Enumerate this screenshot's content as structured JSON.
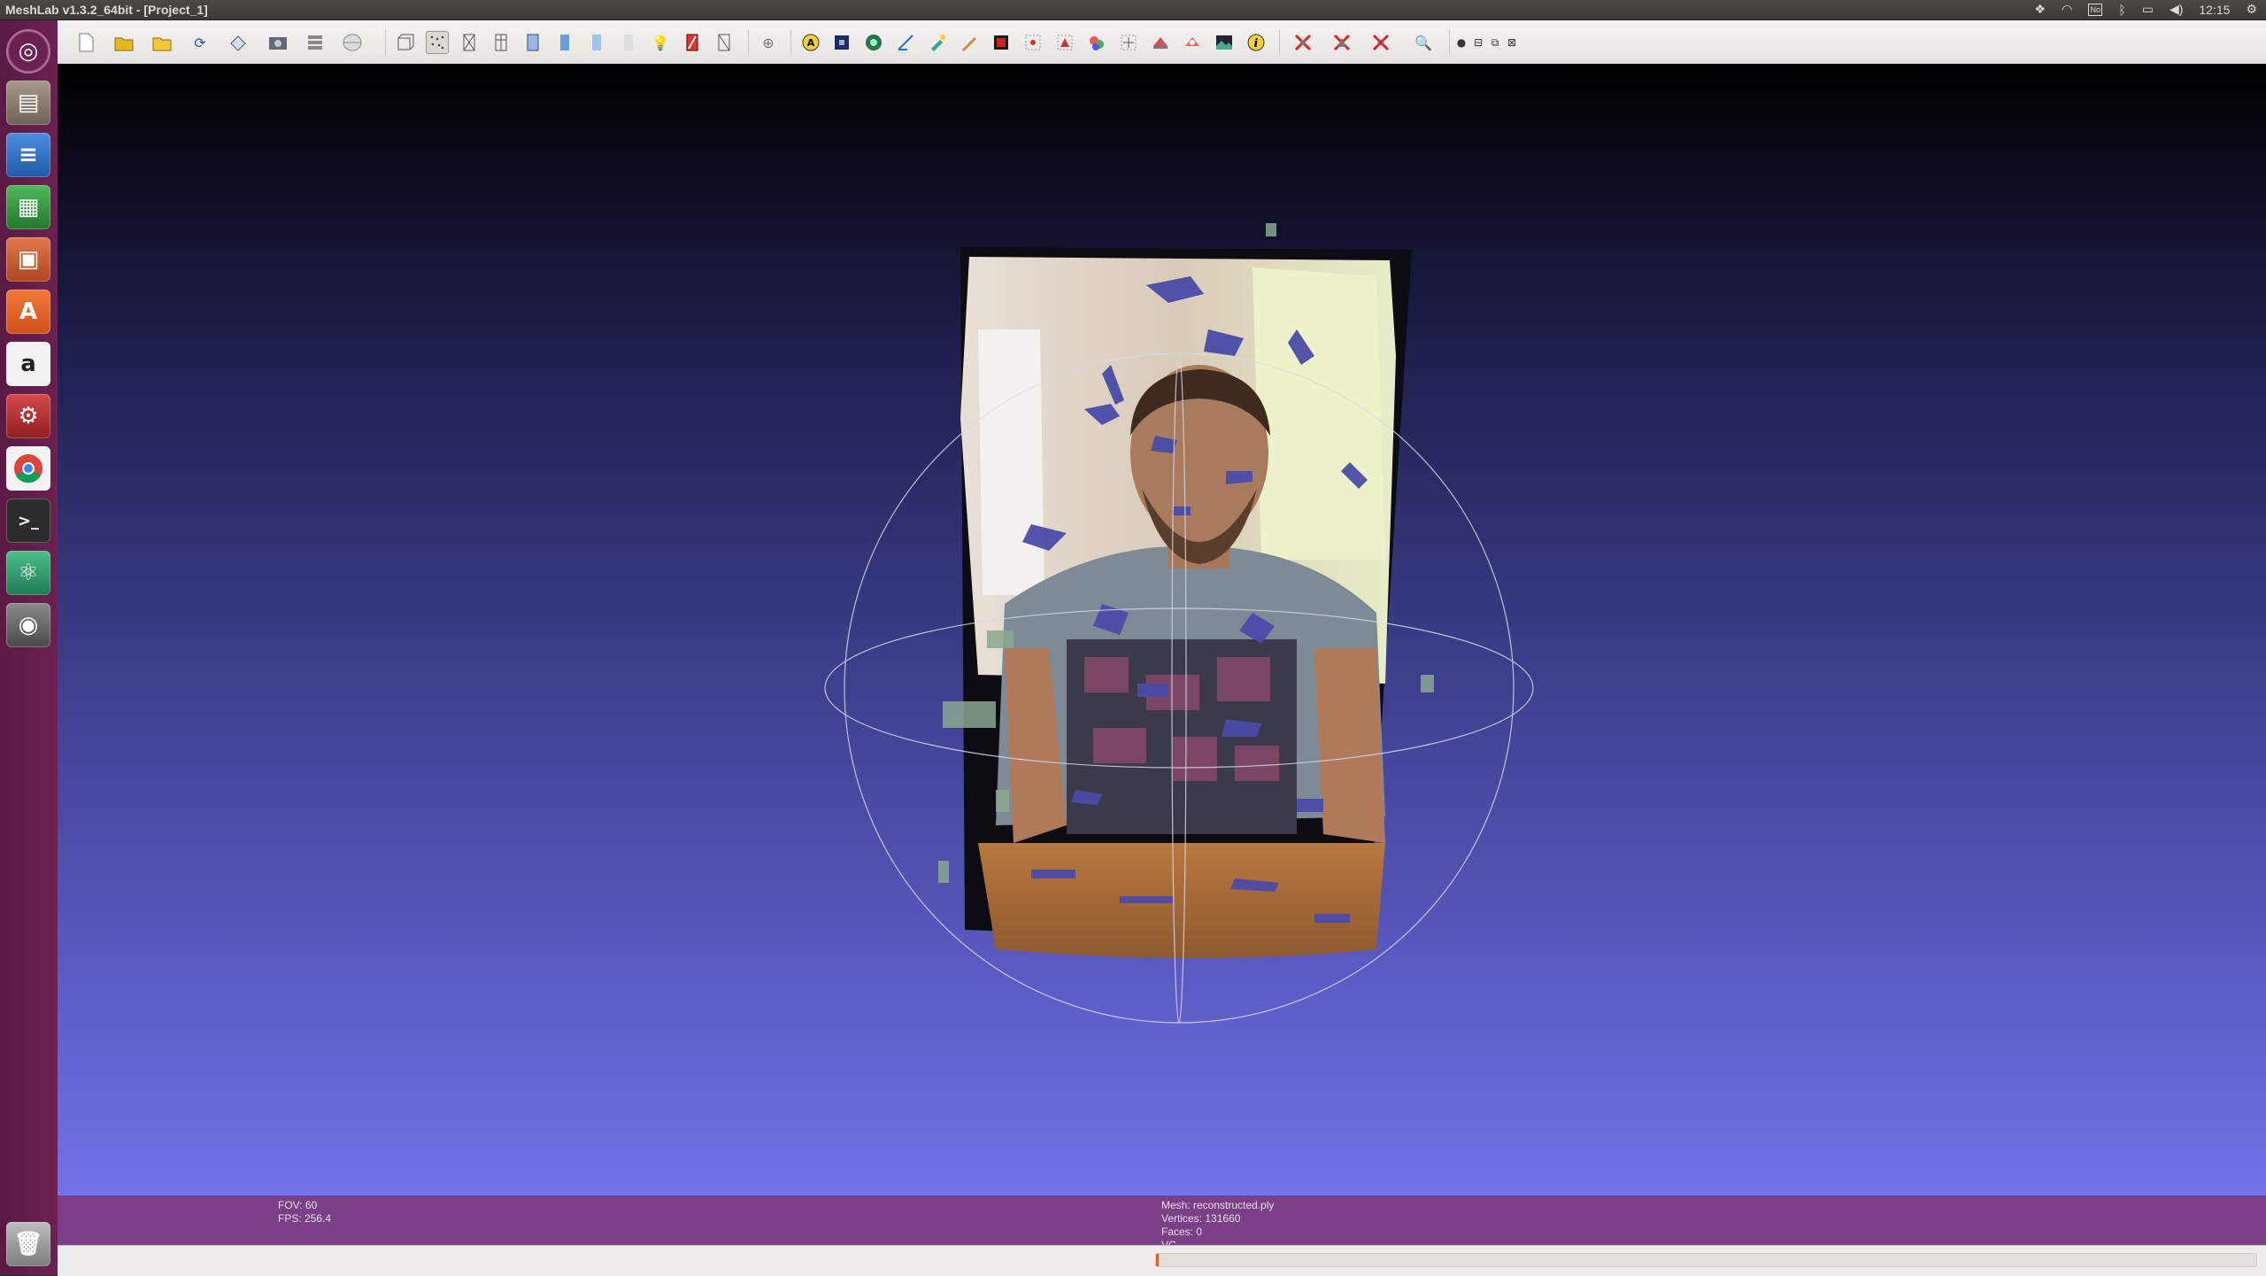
{
  "window": {
    "title": "MeshLab v1.3.2_64bit - [Project_1]"
  },
  "system_tray": {
    "indicators": [
      "dropbox-icon",
      "wifi-icon",
      "keyboard-icon",
      "bluetooth-icon",
      "battery-icon",
      "volume-icon",
      "settings-gear-icon"
    ],
    "keyboard_label": "No",
    "clock": "12:15"
  },
  "launcher": {
    "items": [
      {
        "name": "ubuntu-dash",
        "color": "#6b2152"
      },
      {
        "name": "files",
        "color": "#8c7a6b"
      },
      {
        "name": "libreoffice-writer",
        "color": "#2a6ebf"
      },
      {
        "name": "libreoffice-calc",
        "color": "#2f8f3a"
      },
      {
        "name": "libreoffice-impress",
        "color": "#c2502a"
      },
      {
        "name": "ubuntu-software-center",
        "color": "#e05a1e"
      },
      {
        "name": "amazon",
        "color": "#eaeaea"
      },
      {
        "name": "system-settings",
        "color": "#c33"
      },
      {
        "name": "chrome",
        "color": "#eaeaea"
      },
      {
        "name": "terminal",
        "color": "#2c2c2c"
      },
      {
        "name": "atom",
        "color": "#2f9a6a"
      },
      {
        "name": "meshlab",
        "color": "#606060"
      },
      {
        "name": "trash",
        "color": "#999"
      }
    ]
  },
  "toolbar": {
    "icons": [
      "new-project-icon",
      "open-project-icon",
      "import-mesh-icon",
      "reload-icon",
      "export-mesh-icon",
      "snapshot-icon",
      "layers-icon",
      "spherical-render-icon",
      "bounding-box-icon",
      "points-icon",
      "wireframe-icon",
      "hidden-lines-icon",
      "flat-lines-icon",
      "flat-icon",
      "smooth-icon",
      "lighting-icon",
      "backface-icon",
      "texture-icon",
      "trackball-icon",
      "annotate-icon",
      "quality-mapper-icon",
      "align-icon",
      "measure-icon",
      "paint-icon",
      "sculpt-icon",
      "color-paint-icon",
      "select-vertices-icon",
      "select-faces-icon",
      "z-painting-icon",
      "point-picker-icon",
      "fill-hole-icon",
      "manipulator-icon",
      "raster-align-icon",
      "info-icon",
      "delete-faces-icon",
      "delete-vertices-icon",
      "delete-selection-icon",
      "search-icon",
      "record-icon",
      "window-minimize-icon",
      "window-restore-icon",
      "window-close-icon"
    ]
  },
  "viewport": {
    "info_left": {
      "fov": "FOV: 60",
      "fps": "FPS:   256.4"
    },
    "info_right": {
      "mesh": "Mesh: reconstructed.ply",
      "vertices": "Vertices: 131660",
      "faces": "Faces: 0",
      "vc": "VC"
    }
  },
  "status": {
    "progress_percent": 0
  }
}
